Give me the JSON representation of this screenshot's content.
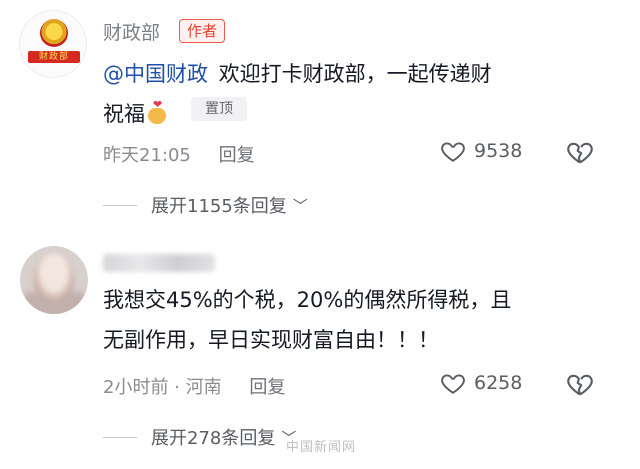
{
  "comments": [
    {
      "username": "财政部",
      "author_tag": "作者",
      "avatar_banner": "财政部",
      "mention": "@中国财政",
      "text": "欢迎打卡财政部，一起传递财祝福",
      "emoji": "heart-hand-emoji",
      "pin_tag": "置顶",
      "time": "昨天21:05",
      "reply_label": "回复",
      "like_count": "9538",
      "expand_label": "展开1155条回复"
    },
    {
      "username": "",
      "text": "我想交45%的个税，20%的偶然所得税，且无副作用，早日实现财富自由！！！",
      "time": "2小时前 · 河南",
      "reply_label": "回复",
      "like_count": "6258",
      "expand_label": "展开278条回复"
    }
  ],
  "watermark": "中国新闻网",
  "colors": {
    "author_tag": "#e8402e",
    "mention": "#1f4fa8",
    "meta_text": "#8a8b91"
  }
}
